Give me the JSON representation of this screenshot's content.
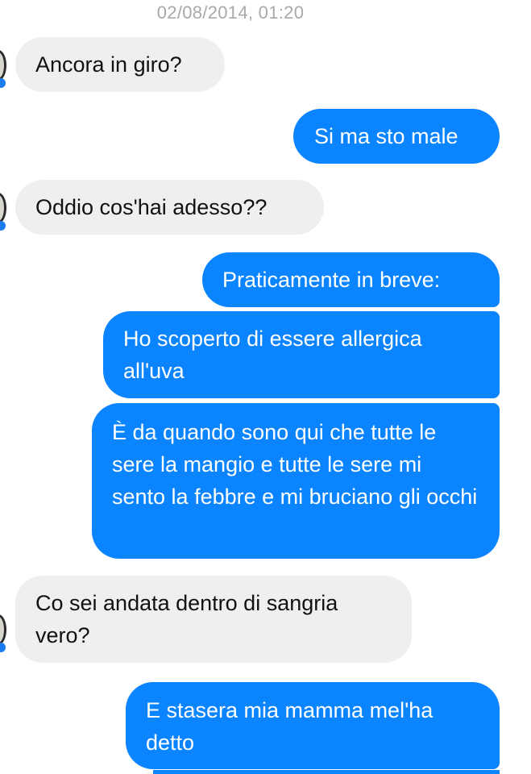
{
  "conversation": {
    "timestamp": "02/08/2014, 01:20",
    "messages": [
      {
        "direction": "incoming",
        "text": "Ancora in giro?"
      },
      {
        "direction": "outgoing",
        "text": "Si ma sto male"
      },
      {
        "direction": "incoming",
        "text": "Oddio cos'hai adesso??"
      },
      {
        "direction": "outgoing",
        "text": "Praticamente in breve:"
      },
      {
        "direction": "outgoing",
        "text": "Ho scoperto di essere allergica all'uva"
      },
      {
        "direction": "outgoing",
        "text": "È da quando sono qui che tutte le sere la mangio e tutte le sere mi sento la febbre e mi bruciano gli occhi"
      },
      {
        "direction": "incoming",
        "text": "Co sei andata dentro di sangria vero?"
      },
      {
        "direction": "outgoing",
        "text": "E stasera mia mamma mel'ha detto"
      }
    ]
  },
  "colors": {
    "outgoing_bubble": "#0a84ff",
    "incoming_bubble": "#efeff2",
    "timestamp_text": "#a8a8ad"
  },
  "icons": {
    "contact_avatar": "avatar-icon",
    "online_status": "status-dot-icon"
  }
}
